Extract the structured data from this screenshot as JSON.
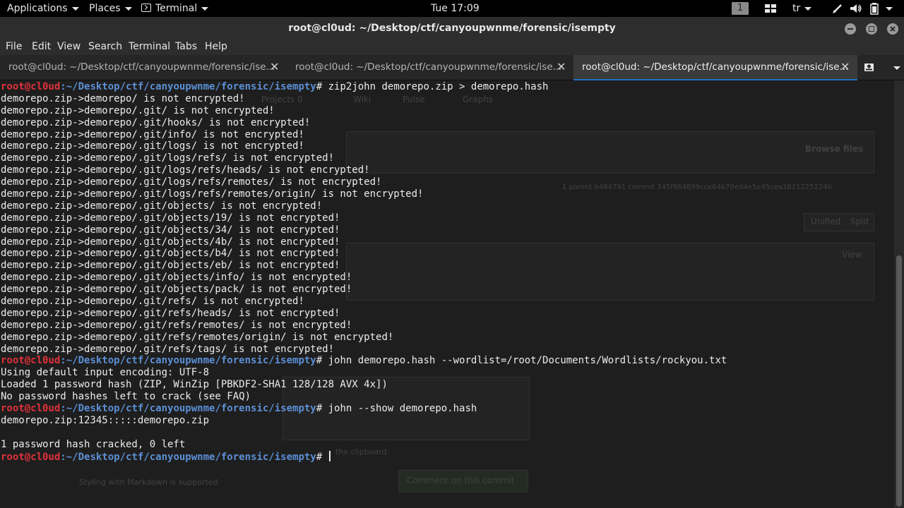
{
  "topbar": {
    "applications": "Applications",
    "places": "Places",
    "terminal": "Terminal",
    "clock": "Tue 17:09",
    "workspace": "1",
    "keyboard_layout": "tr",
    "icons": [
      "terminal-icon",
      "workspace-indicator",
      "apps-grid-icon",
      "pen-icon",
      "volume-icon",
      "battery-icon",
      "power-icon"
    ]
  },
  "window": {
    "title": "root@cl0ud: ~/Desktop/ctf/canyoupwnme/forensic/isempty"
  },
  "menu": [
    "File",
    "Edit",
    "View",
    "Search",
    "Terminal",
    "Tabs",
    "Help"
  ],
  "tabs": [
    {
      "label": "root@cl0ud: ~/Desktop/ctf/canyoupwnme/forensic/ise..."
    },
    {
      "label": "root@cl0ud: ~/Desktop/ctf/canyoupwnme/forensic/ise..."
    },
    {
      "label": "root@cl0ud: ~/Desktop/ctf/canyoupwnme/forensic/ise..."
    }
  ],
  "active_tab": 2,
  "prompt": {
    "user": "root@cl0ud",
    "path": ":~/Desktop/ctf/canyoupwnme/forensic/isempty",
    "symbol": "#"
  },
  "terminal": {
    "lines": [
      {
        "prompt": true,
        "text": " zip2john demorepo.zip > demorepo.hash"
      },
      {
        "text": "demorepo.zip->demorepo/ is not encrypted!"
      },
      {
        "text": "demorepo.zip->demorepo/.git/ is not encrypted!"
      },
      {
        "text": "demorepo.zip->demorepo/.git/hooks/ is not encrypted!"
      },
      {
        "text": "demorepo.zip->demorepo/.git/info/ is not encrypted!"
      },
      {
        "text": "demorepo.zip->demorepo/.git/logs/ is not encrypted!"
      },
      {
        "text": "demorepo.zip->demorepo/.git/logs/refs/ is not encrypted!"
      },
      {
        "text": "demorepo.zip->demorepo/.git/logs/refs/heads/ is not encrypted!"
      },
      {
        "text": "demorepo.zip->demorepo/.git/logs/refs/remotes/ is not encrypted!"
      },
      {
        "text": "demorepo.zip->demorepo/.git/logs/refs/remotes/origin/ is not encrypted!"
      },
      {
        "text": "demorepo.zip->demorepo/.git/objects/ is not encrypted!"
      },
      {
        "text": "demorepo.zip->demorepo/.git/objects/19/ is not encrypted!"
      },
      {
        "text": "demorepo.zip->demorepo/.git/objects/34/ is not encrypted!"
      },
      {
        "text": "demorepo.zip->demorepo/.git/objects/4b/ is not encrypted!"
      },
      {
        "text": "demorepo.zip->demorepo/.git/objects/b4/ is not encrypted!"
      },
      {
        "text": "demorepo.zip->demorepo/.git/objects/eb/ is not encrypted!"
      },
      {
        "text": "demorepo.zip->demorepo/.git/objects/info/ is not encrypted!"
      },
      {
        "text": "demorepo.zip->demorepo/.git/objects/pack/ is not encrypted!"
      },
      {
        "text": "demorepo.zip->demorepo/.git/refs/ is not encrypted!"
      },
      {
        "text": "demorepo.zip->demorepo/.git/refs/heads/ is not encrypted!"
      },
      {
        "text": "demorepo.zip->demorepo/.git/refs/remotes/ is not encrypted!"
      },
      {
        "text": "demorepo.zip->demorepo/.git/refs/remotes/origin/ is not encrypted!"
      },
      {
        "text": "demorepo.zip->demorepo/.git/refs/tags/ is not encrypted!"
      },
      {
        "prompt": true,
        "text": " john demorepo.hash --wordlist=/root/Documents/Wordlists/rockyou.txt"
      },
      {
        "text": "Using default input encoding: UTF-8"
      },
      {
        "text": "Loaded 1 password hash (ZIP, WinZip [PBKDF2-SHA1 128/128 AVX 4x])"
      },
      {
        "text": "No password hashes left to crack (see FAQ)"
      },
      {
        "prompt": true,
        "text": " john --show demorepo.hash"
      },
      {
        "text": "demorepo.zip:12345:::::demorepo.zip"
      },
      {
        "text": ""
      },
      {
        "text": "1 password hash cracked, 0 left"
      },
      {
        "prompt": true,
        "text": " ",
        "cursor": true
      }
    ]
  },
  "background_ghost": {
    "projects": "Projects",
    "projects_count": "0",
    "wiki": "Wiki",
    "pulse": "Pulse",
    "graphs": "Graphs",
    "browse_files": "Browse files",
    "commit_info": "1 parent b484791   commit 345f864899cce64b70ed4e5e45cea3821225124b",
    "unified": "Unified",
    "split": "Split",
    "view": "View",
    "clipboard_hint": "the clipboard.",
    "markdown_hint": "Styling with Markdown is supported",
    "comment_button": "Comment on this commit"
  }
}
